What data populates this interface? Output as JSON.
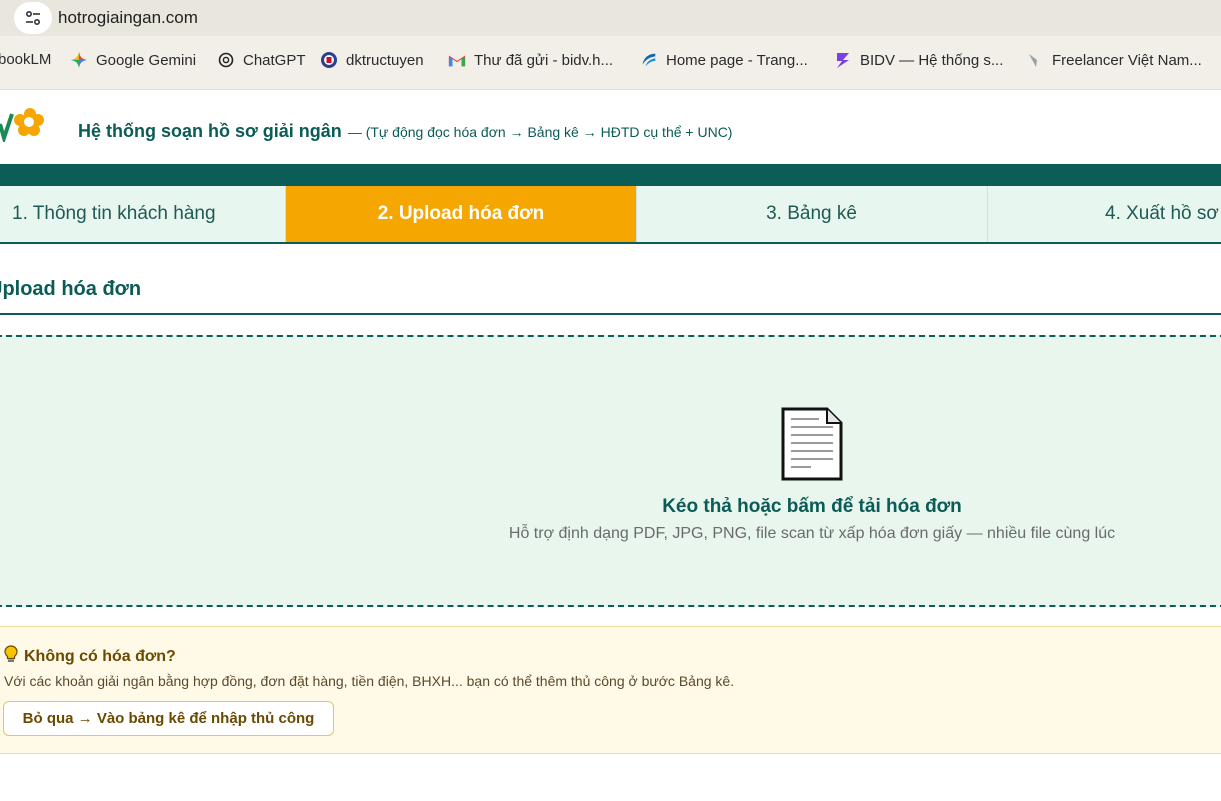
{
  "browser": {
    "url": "hotrogiaingan.com",
    "bookmarks": [
      {
        "label": "bookLM",
        "icon": "notebooklm-icon"
      },
      {
        "label": "Google Gemini",
        "icon": "gemini-icon"
      },
      {
        "label": "ChatGPT",
        "icon": "chatgpt-icon"
      },
      {
        "label": "dktructuyen",
        "icon": "dktructuyen-icon"
      },
      {
        "label": "Thư đã gửi - bidv.h...",
        "icon": "gmail-icon"
      },
      {
        "label": "Home page - Trang...",
        "icon": "homepage-icon"
      },
      {
        "label": "BIDV — Hệ thống s...",
        "icon": "bidv-icon"
      },
      {
        "label": "Freelancer Việt Nam...",
        "icon": "freelancer-icon"
      }
    ]
  },
  "header": {
    "title": "Hệ thống soạn hồ sơ giải ngân",
    "subtitle": "— (Tự động đọc hóa đơn → Bảng kê → HĐTD cụ thể + UNC)"
  },
  "tabs": [
    {
      "label": "1. Thông tin khách hàng",
      "active": false
    },
    {
      "label": "2. Upload hóa đơn",
      "active": true
    },
    {
      "label": "3. Bảng kê",
      "active": false
    },
    {
      "label": "4. Xuất hồ sơ",
      "active": false
    }
  ],
  "section": {
    "title": "Upload hóa đơn"
  },
  "dropzone": {
    "title": "Kéo thả hoặc bấm để tải hóa đơn",
    "subtitle": "Hỗ trợ định dạng PDF, JPG, PNG, file scan từ xấp hóa đơn giấy — nhiều file cùng lúc"
  },
  "notice": {
    "title": "Không có hóa đơn?",
    "text": "Với các khoản giải ngân bằng hợp đồng, đơn đặt hàng, tiền điện, BHXH... bạn có thể thêm thủ công ở bước Bảng kê.",
    "button": "Bỏ qua → Vào bảng kê để nhập thủ công"
  },
  "colors": {
    "primary": "#0c5d58",
    "accent": "#f5a600",
    "dropzone_bg": "#e8f6ee",
    "notice_bg": "#fff9e8"
  }
}
